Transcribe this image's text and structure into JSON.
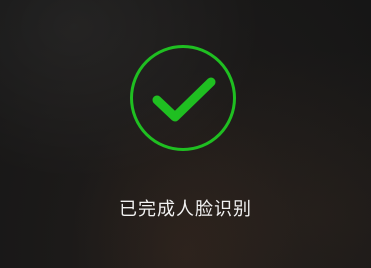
{
  "status": {
    "message": "已完成人脸识别",
    "icon": "checkmark-circle-icon",
    "accent_color": "#1fbf21",
    "text_color": "#f2f2f2"
  }
}
